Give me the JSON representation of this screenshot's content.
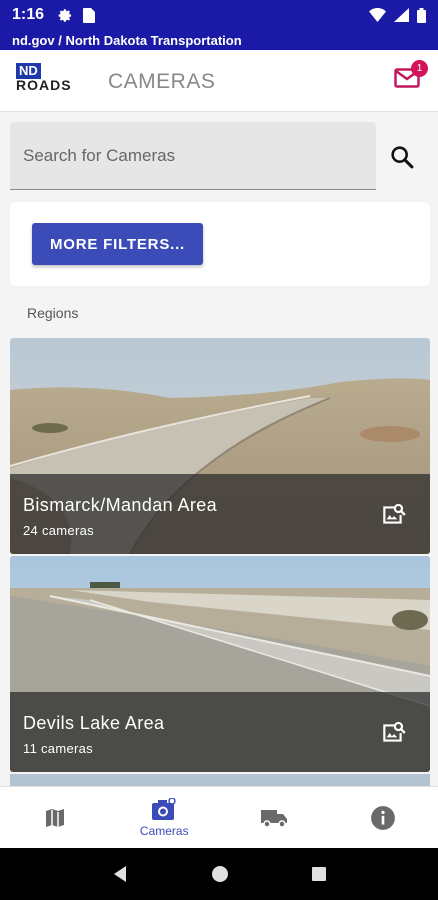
{
  "status_bar": {
    "time": "1:16"
  },
  "url_bar": {
    "text": "nd.gov / North Dakota Transportation"
  },
  "app_bar": {
    "logo_nd": "ND",
    "logo_roads": "ROADS",
    "title": "CAMERAS",
    "notification_count": "1"
  },
  "search": {
    "placeholder": "Search for Cameras",
    "value": ""
  },
  "filters": {
    "button_label": "MORE FILTERS..."
  },
  "regions": {
    "label": "Regions",
    "items": [
      {
        "name": "Bismarck/Mandan Area",
        "count": "24 cameras"
      },
      {
        "name": "Devils Lake Area",
        "count": "11 cameras"
      }
    ]
  },
  "bottom_nav": {
    "items": [
      {
        "icon": "map-icon",
        "label": ""
      },
      {
        "icon": "camera-icon",
        "label": "Cameras",
        "active": true
      },
      {
        "icon": "truck-icon",
        "label": ""
      },
      {
        "icon": "info-icon",
        "label": ""
      }
    ]
  },
  "colors": {
    "status_bar": "#1a1aa6",
    "accent": "#3b4bb8",
    "badge": "#d4145a",
    "mail": "#c2185b"
  }
}
